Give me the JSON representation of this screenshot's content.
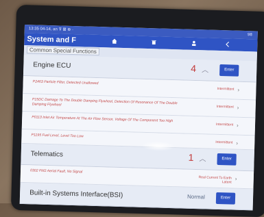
{
  "status_bar": {
    "time": "13:35",
    "date": "04-14, an",
    "icons": "⊽ ⊠ ⊕ ·",
    "battery": "98"
  },
  "header": {
    "title": "System and F",
    "home_icon": "home-icon",
    "delete_icon": "trash-icon",
    "user_icon": "person-icon"
  },
  "subheader": {
    "label": "Common Special Functions"
  },
  "groups": [
    {
      "title": "Engine ECU",
      "count": "4",
      "enter_label": "Enter",
      "faults": [
        {
          "description": "P2463 Particle Filter, Detected Unallowed",
          "status": "Intermittent"
        },
        {
          "description": "P15DC Damage To The Double Damping Flywheel, Detection Of Resonance Of The Double Damping Flywheel",
          "status": "Intermittent"
        },
        {
          "description": "P0113 Inlet Air Temperature At The Air Flow Sensor, Voltage Of The Component Too High",
          "status": "Intermittent"
        },
        {
          "description": "P1195 Fuel Level, Level Too Low",
          "status": "Intermittent"
        }
      ]
    },
    {
      "title": "Telematics",
      "count": "1",
      "enter_label": "Enter",
      "faults": [
        {
          "description": "0302 FM2 Aerial Fault, No Signal",
          "status": "Real Current To Earth Latent"
        }
      ]
    },
    {
      "title": "Built-in Systems Interface(BSI)",
      "status": "Normal",
      "enter_label": "Enter"
    }
  ],
  "colors": {
    "accent": "#2f54c4",
    "fault_text": "#c44b4b",
    "count": "#c23a3a"
  }
}
